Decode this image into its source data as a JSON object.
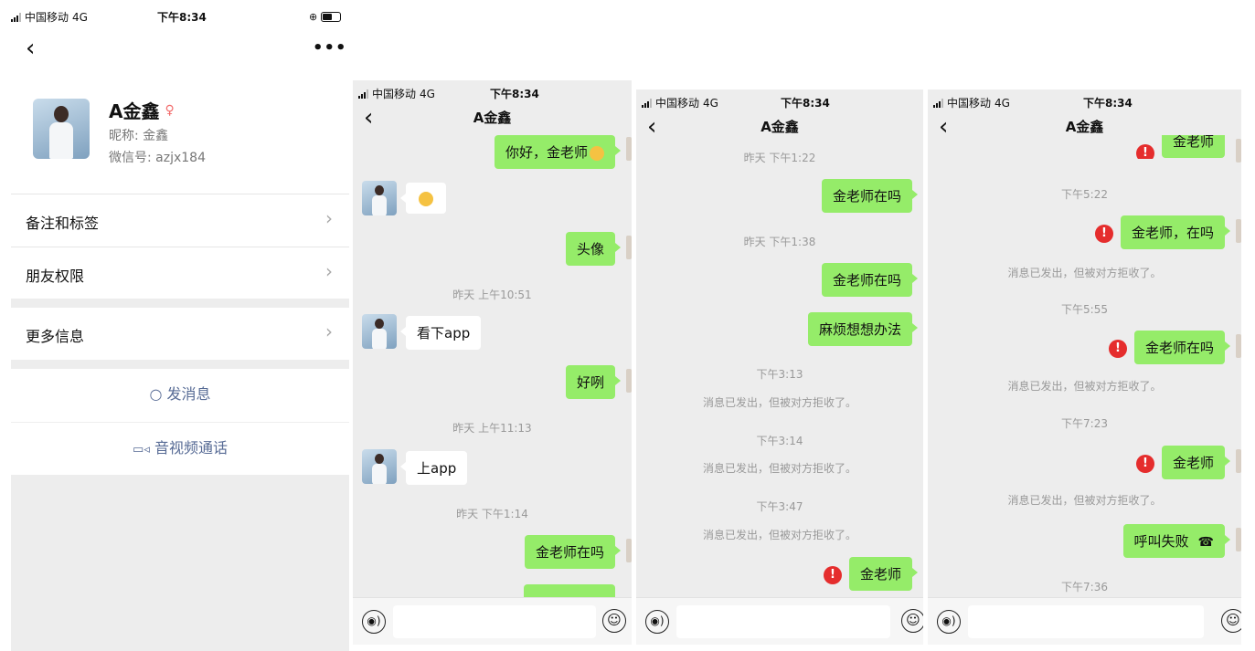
{
  "profile": {
    "carrier": "中国移动",
    "network": "4G",
    "time": "下午8:34",
    "back_icon": "chevron-left-icon",
    "more_label": "•••",
    "name": "A金鑫",
    "nickname": "昵称: 金鑫",
    "wechat_id": "微信号: azjx184",
    "menu": [
      {
        "label": "备注和标签"
      },
      {
        "label": "朋友权限"
      },
      {
        "label": "更多信息"
      }
    ],
    "send_message": "发消息",
    "video_call": "音视频通话"
  },
  "chat1": {
    "carrier": "中国移动",
    "network": "4G",
    "time": "下午8:34",
    "title": "A金鑫",
    "messages": {
      "m1": "你好，金老师",
      "m2": "头像",
      "t1": "昨天 上午10:51",
      "m3": "看下app",
      "m4": "好咧",
      "t2": "昨天 上午11:13",
      "m5": "上app",
      "t3": "昨天 下午1:14",
      "m6": "金老师在吗"
    }
  },
  "chat2": {
    "carrier": "中国移动",
    "network": "4G",
    "time": "下午8:34",
    "title": "A金鑫",
    "messages": {
      "t1": "昨天 下午1:22",
      "m1": "金老师在吗",
      "t2": "昨天 下午1:38",
      "m2": "金老师在吗",
      "m3": "麻烦想想办法",
      "t3": "下午3:13",
      "s1": "消息已发出，但被对方拒收了。",
      "t4": "下午3:14",
      "s2": "消息已发出，但被对方拒收了。",
      "t5": "下午3:47",
      "s3": "消息已发出，但被对方拒收了。",
      "m4": "金老师"
    }
  },
  "chat3": {
    "carrier": "中国移动",
    "network": "4G",
    "time": "下午8:34",
    "title": "A金鑫",
    "messages": {
      "m0": "金老师",
      "t1": "下午5:22",
      "m1": "金老师，在吗",
      "s1": "消息已发出，但被对方拒收了。",
      "t2": "下午5:55",
      "m2": "金老师在吗",
      "s2": "消息已发出，但被对方拒收了。",
      "t3": "下午7:23",
      "m3": "金老师",
      "s3": "消息已发出，但被对方拒收了。",
      "m4": "呼叫失败",
      "t4": "下午7:36"
    }
  },
  "icons": {
    "error": "!",
    "voice": "◉)",
    "emoji": "☺",
    "chevron": "›",
    "back": "‹",
    "chat_bubble": "○",
    "video": "▭◃",
    "phone": "☎"
  }
}
